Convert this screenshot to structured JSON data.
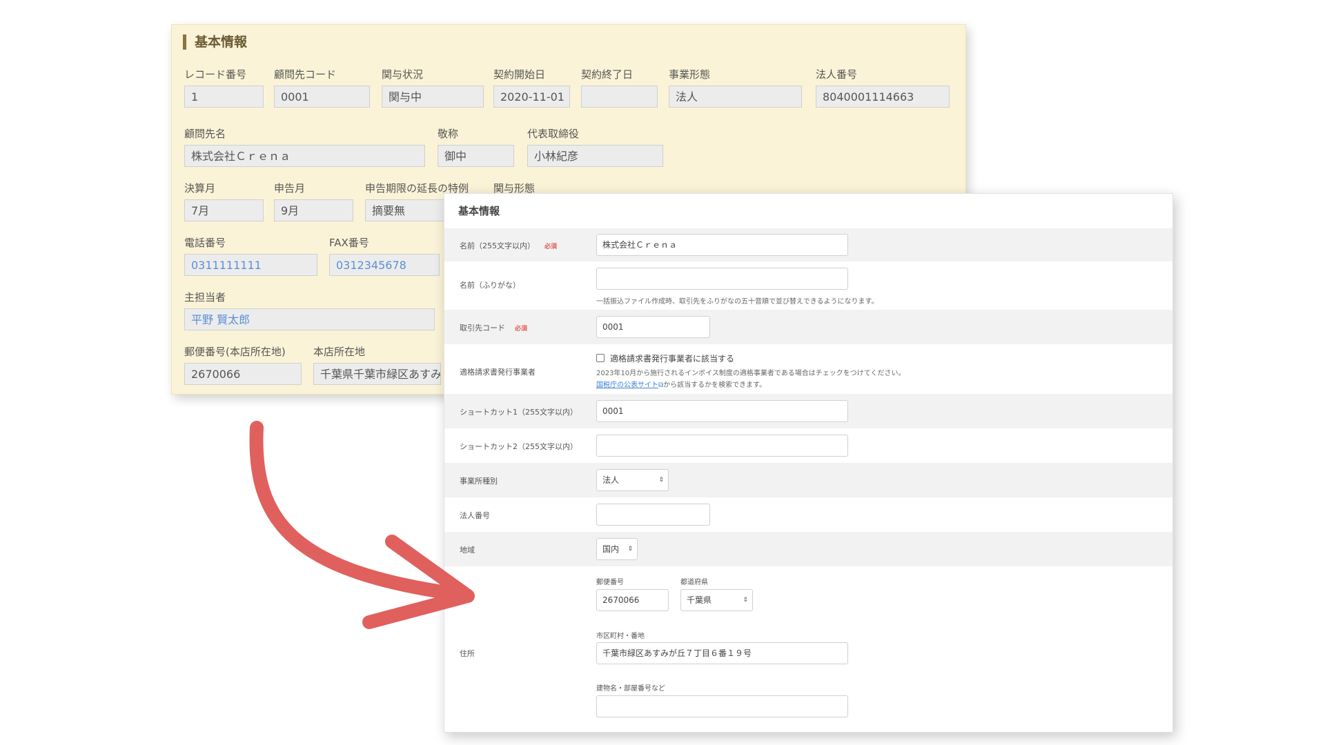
{
  "old": {
    "title": "基本情報",
    "fields": [
      {
        "label": "レコード番号",
        "value": "1"
      },
      {
        "label": "顧問先コード",
        "value": "0001"
      },
      {
        "label": "関与状況",
        "value": "関与中"
      },
      {
        "label": "契約開始日",
        "value": "2020-11-01"
      },
      {
        "label": "契約終了日",
        "value": ""
      },
      {
        "label": "事業形態",
        "value": "法人"
      },
      {
        "label": "法人番号",
        "value": "8040001114663"
      },
      {
        "label": "顧問先名",
        "value": "株式会社Ｃｒｅｎａ"
      },
      {
        "label": "敬称",
        "value": "御中"
      },
      {
        "label": "代表取締役",
        "value": "小林紀彦"
      },
      {
        "label": "決算月",
        "value": "7月"
      },
      {
        "label": "申告月",
        "value": "9月"
      },
      {
        "label": "申告期限の延長の特例",
        "value": "摘要無"
      },
      {
        "label": "関与形態",
        "value": ""
      },
      {
        "label": "電話番号",
        "value": "0311111111"
      },
      {
        "label": "FAX番号",
        "value": "0312345678"
      },
      {
        "label": "主担当者",
        "value": "平野 賢太郎"
      },
      {
        "label": "郵便番号(本店所在地)",
        "value": "2670066"
      },
      {
        "label": "本店所在地",
        "value": "千葉県千葉市緑区あすみが"
      }
    ]
  },
  "new": {
    "title": "基本情報",
    "required_badge": "必須",
    "name_label": "名前（255文字以内）",
    "name_value": "株式会社Ｃｒｅｎａ",
    "kana_label": "名前（ふりがな）",
    "kana_value": "",
    "kana_help": "一括振込ファイル作成時、取引先をふりがなの五十音順で並び替えできるようになります。",
    "code_label": "取引先コード",
    "code_value": "0001",
    "invoice_label": "適格請求書発行事業者",
    "invoice_checkbox_label": "適格請求書発行事業者に該当する",
    "invoice_help1": "2023年10月から施行されるインボイス制度の適格事業者である場合はチェックをつけてください。",
    "invoice_link": "国税庁の公表サイト",
    "invoice_help2": "から該当するかを検索できます。",
    "shortcut1_label": "ショートカット1（255文字以内）",
    "shortcut1_value": "0001",
    "shortcut2_label": "ショートカット2（255文字以内）",
    "shortcut2_value": "",
    "office_type_label": "事業所種別",
    "office_type_value": "法人",
    "corp_no_label": "法人番号",
    "corp_no_value": "",
    "region_label": "地域",
    "region_value": "国内",
    "address_label": "住所",
    "postal_label": "郵便番号",
    "postal_value": "2670066",
    "pref_label": "都道府県",
    "pref_value": "千葉県",
    "city_label": "市区町村・番地",
    "city_value": "千葉市緑区あすみが丘７丁目６番１９号",
    "building_label": "建物名・部屋番号など",
    "building_value": ""
  },
  "colors": {
    "old_bg": "#fbf3d7",
    "arrow": "#e0605e",
    "link": "#3d7fd4",
    "required": "#e05a5a"
  }
}
